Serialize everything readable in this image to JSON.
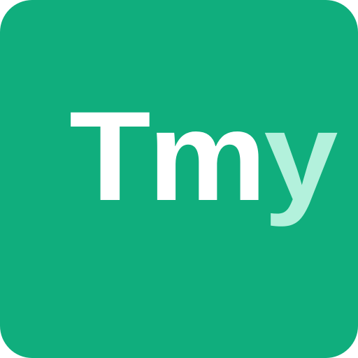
{
  "logo": {
    "text_main": "Tm",
    "text_accent": "y"
  },
  "colors": {
    "background": "#10ae7d",
    "main_text": "#ffffff",
    "accent_text": "#b3f1dc"
  }
}
